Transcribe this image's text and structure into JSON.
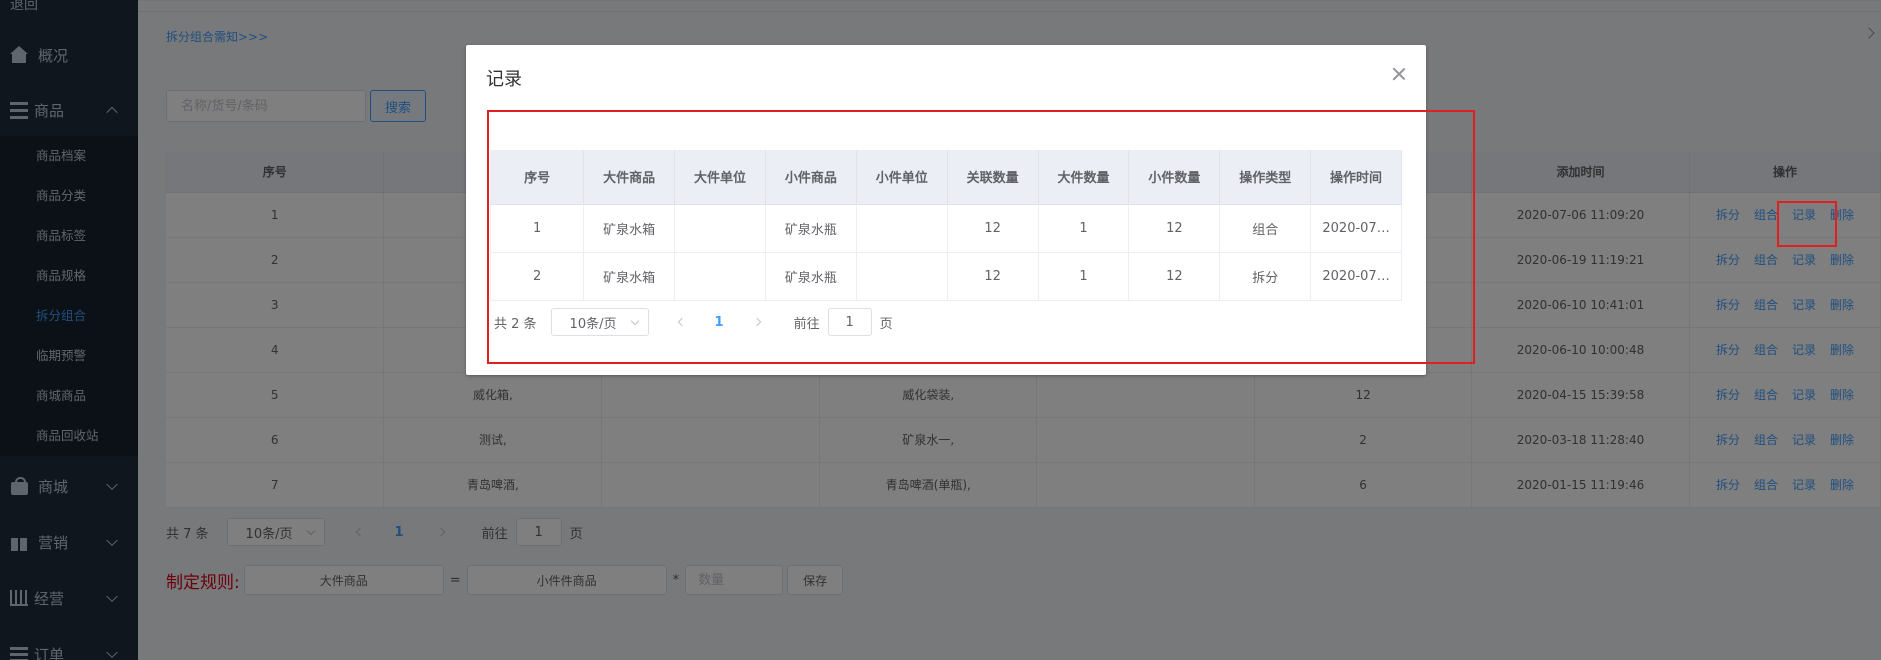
{
  "sidebar": {
    "top_partial": "退回",
    "menu": [
      {
        "label": "概况",
        "icon": "home-icon"
      },
      {
        "label": "商品",
        "icon": "bars-icon"
      },
      {
        "label": "商城",
        "icon": "bag-icon"
      },
      {
        "label": "营销",
        "icon": "gift-icon"
      },
      {
        "label": "经营",
        "icon": "chart-icon"
      },
      {
        "label": "订单",
        "icon": "list-icon"
      }
    ],
    "sub_items": [
      "商品档案",
      "商品分类",
      "商品标签",
      "商品规格",
      "拆分组合",
      "临期预警",
      "商城商品",
      "商品回收站"
    ],
    "active_sub": "拆分组合",
    "active_color": "#409eff"
  },
  "notice": {
    "link": "拆分组合需知>>>"
  },
  "search": {
    "placeholder": "名称/货号/条码",
    "button": "搜索"
  },
  "main_table": {
    "headers": [
      "序号",
      "",
      "",
      "",
      "",
      "",
      "添加时间",
      "操作"
    ],
    "rows": [
      {
        "index": "1",
        "big": "",
        "small": "",
        "qty": "",
        "time": "2020-07-06 11:09:20"
      },
      {
        "index": "2",
        "big": "",
        "small": "",
        "qty": "",
        "time": "2020-06-19 11:19:21"
      },
      {
        "index": "3",
        "big": "",
        "small": "",
        "qty": "",
        "time": "2020-06-10 10:41:01"
      },
      {
        "index": "4",
        "big": "",
        "small": "",
        "qty": "",
        "time": "2020-06-10 10:00:48"
      },
      {
        "index": "5",
        "big": "威化箱,",
        "small": "威化袋装,",
        "qty": "12",
        "time": "2020-04-15 15:39:58"
      },
      {
        "index": "6",
        "big": "测试,",
        "small": "矿泉水一,",
        "qty": "2",
        "time": "2020-03-18 11:28:40"
      },
      {
        "index": "7",
        "big": "青岛啤酒,",
        "small": "青岛啤酒(单瓶),",
        "qty": "6",
        "time": "2020-01-15 11:19:46"
      }
    ],
    "ops": [
      "拆分",
      "组合",
      "记录",
      "删除"
    ]
  },
  "main_pager": {
    "total": "共 7 条",
    "page_size": "10条/页",
    "current": "1",
    "goto_prefix": "前往",
    "goto_value": "1",
    "goto_suffix": "页"
  },
  "rule": {
    "label": "制定规则:",
    "big": "大件商品",
    "eq": "=",
    "small": "小件件商品",
    "mult": "*",
    "qty_placeholder": "数量",
    "save": "保存"
  },
  "dialog": {
    "title": "记录",
    "headers": [
      "序号",
      "大件商品",
      "大件单位",
      "小件商品",
      "小件单位",
      "关联数量",
      "大件数量",
      "小件数量",
      "操作类型",
      "操作时间"
    ],
    "rows": [
      [
        "1",
        "矿泉水箱",
        "",
        "矿泉水瓶",
        "",
        "12",
        "1",
        "12",
        "组合",
        "2020-07…"
      ],
      [
        "2",
        "矿泉水箱",
        "",
        "矿泉水瓶",
        "",
        "12",
        "1",
        "12",
        "拆分",
        "2020-07…"
      ]
    ],
    "pager": {
      "total": "共 2 条",
      "page_size": "10条/页",
      "current": "1",
      "goto_prefix": "前往",
      "goto_value": "1",
      "goto_suffix": "页"
    }
  },
  "highlight_color": "#e02020"
}
